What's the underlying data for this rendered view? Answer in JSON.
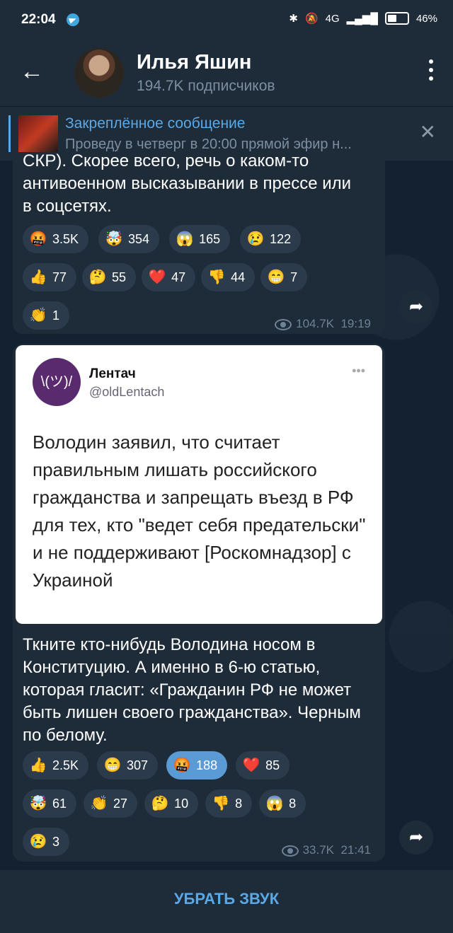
{
  "status_bar": {
    "time": "22:04",
    "battery": "46%",
    "network": "4G"
  },
  "header": {
    "title": "Илья Яшин",
    "subtitle": "194.7K подписчиков"
  },
  "pinned": {
    "title": "Закреплённое сообщение",
    "text": "Проведу в четверг в 20:00 прямой эфир н..."
  },
  "message1": {
    "text": "СКР). Скорее всего, речь о каком-то антивоенном высказывании в прессе или в соцсетях.",
    "reactions": [
      {
        "emoji": "🤬",
        "count": "3.5K"
      },
      {
        "emoji": "🤯",
        "count": "354"
      },
      {
        "emoji": "😱",
        "count": "165"
      },
      {
        "emoji": "😢",
        "count": "122"
      },
      {
        "emoji": "👍",
        "count": "77"
      },
      {
        "emoji": "🤔",
        "count": "55"
      },
      {
        "emoji": "❤️",
        "count": "47"
      },
      {
        "emoji": "👎",
        "count": "44"
      },
      {
        "emoji": "😁",
        "count": "7"
      },
      {
        "emoji": "👏",
        "count": "1"
      }
    ],
    "views": "104.7K",
    "time": "19:19"
  },
  "message2": {
    "tweet": {
      "avatar_text": "\\(ツ)/",
      "name": "Лентач",
      "handle": "@oldLentach",
      "text": "Володин заявил, что считает правильным лишать российского гражданства и запрещать въезд в РФ для тех, кто \"ведет себя предательски\" и не поддерживают [Роскомнадзор] с Украиной"
    },
    "text": "Ткните кто-нибудь Володина носом в Конституцию. А именно в 6-ю статью, которая гласит: «Гражданин РФ не может быть лишен своего гражданства». Черным по белому.",
    "reactions": [
      {
        "emoji": "👍",
        "count": "2.5K"
      },
      {
        "emoji": "😁",
        "count": "307"
      },
      {
        "emoji": "🤬",
        "count": "188",
        "active": true
      },
      {
        "emoji": "❤️",
        "count": "85"
      },
      {
        "emoji": "🤯",
        "count": "61"
      },
      {
        "emoji": "👏",
        "count": "27"
      },
      {
        "emoji": "🤔",
        "count": "10"
      },
      {
        "emoji": "👎",
        "count": "8"
      },
      {
        "emoji": "😱",
        "count": "8"
      },
      {
        "emoji": "😢",
        "count": "3"
      }
    ],
    "views": "33.7K",
    "time": "21:41"
  },
  "bottom": {
    "button_label": "УБРАТЬ ЗВУК"
  },
  "colors": {
    "accent": "#5aa8e6",
    "bubble": "#1e2c3a",
    "background": "#142130"
  }
}
